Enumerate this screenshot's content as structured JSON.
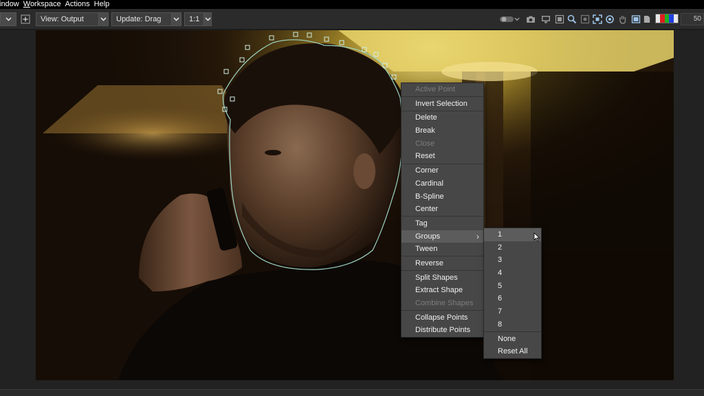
{
  "menubar": {
    "items": [
      {
        "label": "Window",
        "display": "indow",
        "ul": ""
      },
      {
        "label": "Workspace",
        "display": "Workspace",
        "ul": "W"
      },
      {
        "label": "Actions",
        "display": "Actions",
        "ul": ""
      },
      {
        "label": "Help",
        "display": "Help",
        "ul": ""
      }
    ]
  },
  "toolbar": {
    "view_label": "View: Output",
    "update_label": "Update: Drag",
    "ratio_label": "1:1",
    "zoom_value": "50",
    "icons": [
      "toggle-icon",
      "camera-icon",
      "monitor-icon",
      "frame-icon",
      "magnifier-icon",
      "record-icon",
      "fit-icon",
      "target-icon",
      "hand-icon",
      "overlay-icon",
      "page-icon"
    ]
  },
  "context_menu": {
    "items": [
      {
        "label": "Active Point",
        "disabled": true
      },
      {
        "sep": true
      },
      {
        "label": "Invert Selection"
      },
      {
        "sep": true
      },
      {
        "label": "Delete"
      },
      {
        "label": "Break"
      },
      {
        "label": "Close",
        "disabled": true
      },
      {
        "label": "Reset"
      },
      {
        "sep": true
      },
      {
        "label": "Corner"
      },
      {
        "label": "Cardinal"
      },
      {
        "label": "B-Spline"
      },
      {
        "label": "Center"
      },
      {
        "sep": true
      },
      {
        "label": "Tag"
      },
      {
        "label": "Groups",
        "submenu": true,
        "highlight": true
      },
      {
        "label": "Tween"
      },
      {
        "sep": true
      },
      {
        "label": "Reverse"
      },
      {
        "sep": true
      },
      {
        "label": "Split Shapes"
      },
      {
        "label": "Extract Shape"
      },
      {
        "label": "Combine Shapes",
        "disabled": true
      },
      {
        "sep": true
      },
      {
        "label": "Collapse Points"
      },
      {
        "label": "Distribute Points"
      }
    ]
  },
  "groups_submenu": {
    "items": [
      {
        "label": "1",
        "highlight": true
      },
      {
        "label": "2"
      },
      {
        "label": "3"
      },
      {
        "label": "4"
      },
      {
        "label": "5"
      },
      {
        "label": "6"
      },
      {
        "label": "7"
      },
      {
        "label": "8"
      },
      {
        "sep": true
      },
      {
        "label": "None"
      },
      {
        "label": "Reset All"
      }
    ]
  },
  "colors": {
    "accent_spline": "#9ed6c4",
    "menu_bg": "#474747",
    "menu_highlight": "#5c5c5c"
  }
}
